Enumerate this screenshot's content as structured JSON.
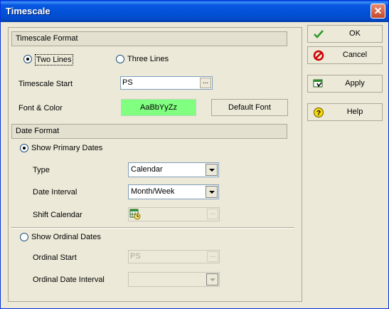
{
  "window": {
    "title": "Timescale",
    "close_label": "✕"
  },
  "timescale_format": {
    "header": "Timescale Format",
    "option_two_lines": "Two Lines",
    "option_three_lines": "Three Lines",
    "selected": "Two Lines"
  },
  "timescale_start": {
    "label": "Timescale Start",
    "value": "PS",
    "browse_label": "..."
  },
  "font_color": {
    "label": "Font & Color",
    "sample_text": "AaBbYyZz",
    "sample_color": "#80ff80",
    "default_font_label": "Default Font"
  },
  "date_format": {
    "header": "Date Format",
    "show_primary_label": "Show Primary Dates",
    "show_primary_checked": true,
    "type_label": "Type",
    "type_value": "Calendar",
    "interval_label": "Date Interval",
    "interval_value": "Month/Week",
    "shift_label": "Shift Calendar",
    "shift_icon": "calendar-icon",
    "shift_browse": "...",
    "show_ordinal_label": "Show Ordinal Dates",
    "show_ordinal_checked": false,
    "ordinal_start_label": "Ordinal Start",
    "ordinal_start_value": "PS",
    "ordinal_start_browse": "...",
    "ordinal_interval_label": "Ordinal Date Interval",
    "ordinal_interval_value": ""
  },
  "buttons": {
    "ok": "OK",
    "cancel": "Cancel",
    "apply": "Apply",
    "help": "Help"
  },
  "colors": {
    "title_bar": "#0151d6",
    "ok_icon": "#2a9a2a",
    "cancel_icon": "#cc0000",
    "help_icon": "#e6c000"
  }
}
